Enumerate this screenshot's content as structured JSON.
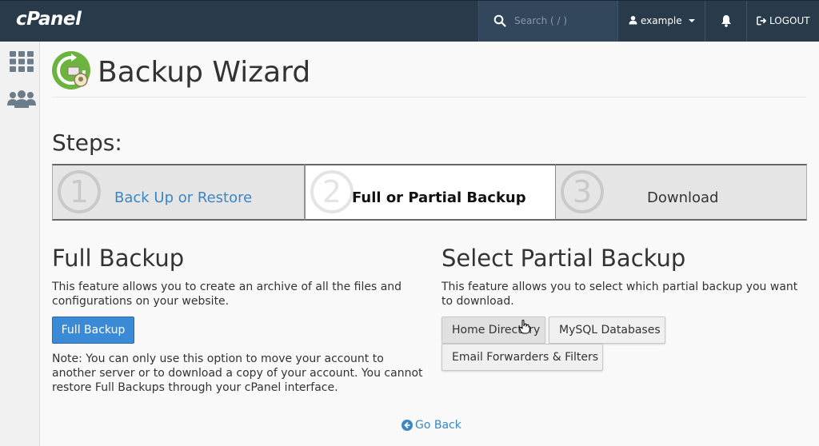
{
  "brand": {
    "logo_text": "cPanel"
  },
  "topbar": {
    "search_placeholder": "Search ( / )",
    "username": "example",
    "logout_label": "LOGOUT"
  },
  "page": {
    "title": "Backup Wizard"
  },
  "steps": {
    "heading": "Steps:",
    "items": [
      {
        "number": "1",
        "label": "Back Up or Restore",
        "state": "link"
      },
      {
        "number": "2",
        "label": "Full or Partial Backup",
        "state": "current"
      },
      {
        "number": "3",
        "label": "Download",
        "state": "upcoming"
      }
    ]
  },
  "full_backup": {
    "title": "Full Backup",
    "description": "This feature allows you to create an archive of all the files and configurations on your website.",
    "button_label": "Full Backup",
    "note": "Note: You can only use this option to move your account to another server or to download a copy of your account. You cannot restore Full Backups through your cPanel interface."
  },
  "partial_backup": {
    "title": "Select Partial Backup",
    "description": "This feature allows you to select which partial backup you want to download.",
    "buttons": [
      "Home Directory",
      "MySQL Databases",
      "Email Forwarders & Filters"
    ]
  },
  "go_back_label": "Go Back",
  "colors": {
    "topbar": "#293a4a",
    "accent": "#3a8ad5",
    "link": "#3b86c4",
    "app_icon": "#6cb33f"
  }
}
